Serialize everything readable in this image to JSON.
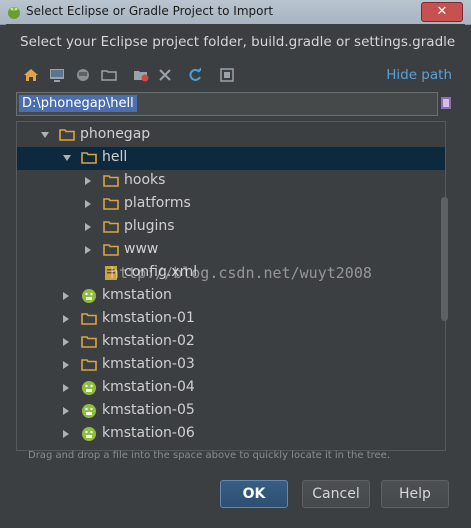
{
  "window": {
    "title": "Select Eclipse or Gradle Project to Import",
    "close_label": "✕"
  },
  "prompt": "Select your Eclipse project folder, build.gradle or settings.gradle",
  "toolbar": {
    "icons": [
      "home-icon",
      "desktop-icon",
      "android-icon",
      "folder-icon",
      "new-folder-icon",
      "delete-icon",
      "refresh-icon",
      "show-hidden-icon"
    ],
    "hide_path_label": "Hide path"
  },
  "path": {
    "value": "D:\\phonegap\\hell"
  },
  "tree": {
    "items": [
      {
        "label": "phonegap",
        "type": "folder",
        "expanded": true,
        "depth": 1
      },
      {
        "label": "hell",
        "type": "folder",
        "expanded": true,
        "depth": 2,
        "selected": true
      },
      {
        "label": "hooks",
        "type": "folder",
        "expanded": false,
        "depth": 3
      },
      {
        "label": "platforms",
        "type": "folder",
        "expanded": false,
        "depth": 3
      },
      {
        "label": "plugins",
        "type": "folder",
        "expanded": false,
        "depth": 3
      },
      {
        "label": "www",
        "type": "folder",
        "expanded": false,
        "depth": 3
      },
      {
        "label": "config.xml",
        "type": "file",
        "depth": 3
      },
      {
        "label": "kmstation",
        "type": "android",
        "expanded": false,
        "depth": 2
      },
      {
        "label": "kmstation-01",
        "type": "folder",
        "expanded": false,
        "depth": 2
      },
      {
        "label": "kmstation-02",
        "type": "folder",
        "expanded": false,
        "depth": 2
      },
      {
        "label": "kmstation-03",
        "type": "folder",
        "expanded": false,
        "depth": 2
      },
      {
        "label": "kmstation-04",
        "type": "android",
        "expanded": false,
        "depth": 2
      },
      {
        "label": "kmstation-05",
        "type": "android",
        "expanded": false,
        "depth": 2
      },
      {
        "label": "kmstation-06",
        "type": "android",
        "expanded": false,
        "depth": 2
      }
    ]
  },
  "hint": "Drag and drop a file into the space above to quickly locate it in the tree.",
  "buttons": {
    "ok": "OK",
    "cancel": "Cancel",
    "help": "Help"
  },
  "watermark": "http://blog.csdn.net/wuyt2008",
  "colors": {
    "accent": "#5c9fd9",
    "selection": "#0d293e",
    "folder": "#d9a441",
    "android": "#8dbf3a"
  }
}
